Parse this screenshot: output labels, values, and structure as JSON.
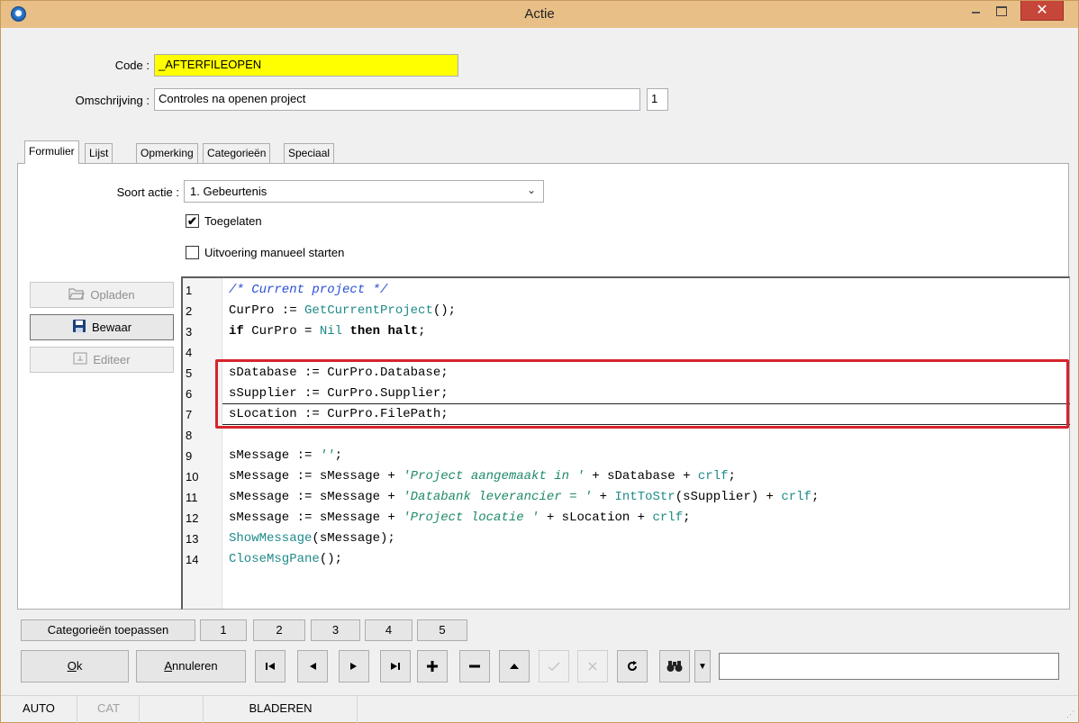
{
  "window": {
    "title": "Actie",
    "close_label": "✕"
  },
  "form": {
    "code_label": "Code :",
    "code_value": "_AFTERFILEOPEN",
    "desc_label": "Omschrijving :",
    "desc_value": "Controles na openen project",
    "desc_counter": "1"
  },
  "tabs": [
    {
      "label": "Formulier",
      "active": true
    },
    {
      "label": "Lijst",
      "active": false
    },
    {
      "label": "Opmerking",
      "active": false
    },
    {
      "label": "Categorieën",
      "active": false
    },
    {
      "label": "Speciaal",
      "active": false
    }
  ],
  "panel": {
    "soort_label": "Soort actie :",
    "soort_value": "1.  Gebeurtenis",
    "toegelaten_label": "Toegelaten",
    "toegelaten_checked": true,
    "manueel_label": "Uitvoering manueel starten",
    "manueel_checked": false
  },
  "side_buttons": {
    "opladen": "Opladen",
    "bewaar": "Bewaar",
    "editeer": "Editeer"
  },
  "code": {
    "line_numbers": [
      "1",
      "2",
      "3",
      "4",
      "5",
      "6",
      "7",
      "8",
      "9",
      "10",
      "11",
      "12",
      "13",
      "14"
    ]
  },
  "categories": {
    "apply_label": "Categorieën toepassen",
    "numbers": [
      "1",
      "2",
      "3",
      "4",
      "5"
    ]
  },
  "buttons": {
    "ok": "k",
    "ok_underline": "O",
    "cancel": "nnuleren",
    "cancel_underline": "A"
  },
  "nav_icons": [
    "first-record-icon",
    "prev-record-icon",
    "next-record-icon",
    "last-record-icon",
    "add-record-icon",
    "delete-record-icon",
    "up-icon",
    "post-icon",
    "cancel-edit-icon",
    "refresh-icon",
    "find-icon"
  ],
  "status": {
    "mode": "AUTO",
    "cat": "CAT",
    "state": "BLADEREN"
  },
  "colors": {
    "titlebar": "#e8bf86",
    "code_highlight": "#ffff00",
    "annotation_box": "#d6242c"
  }
}
